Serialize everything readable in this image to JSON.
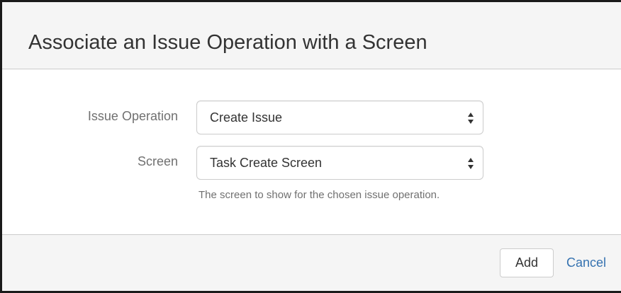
{
  "dialog": {
    "title": "Associate an Issue Operation with a Screen"
  },
  "form": {
    "issue_operation": {
      "label": "Issue Operation",
      "selected": "Create Issue"
    },
    "screen": {
      "label": "Screen",
      "selected": "Task Create Screen",
      "help": "The screen to show for the chosen issue operation."
    }
  },
  "footer": {
    "add_label": "Add",
    "cancel_label": "Cancel"
  },
  "colors": {
    "link": "#3572b0",
    "label_text": "#707070",
    "header_bg": "#f5f5f5"
  }
}
